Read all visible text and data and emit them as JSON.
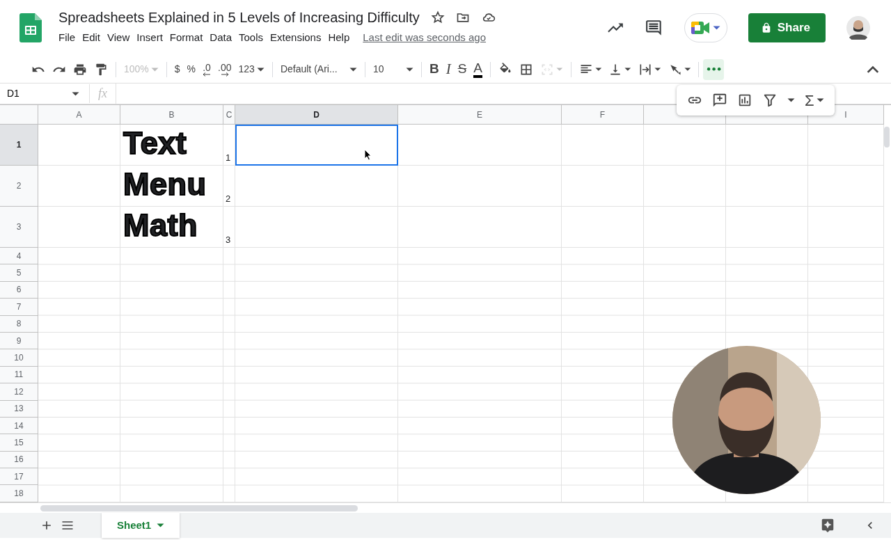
{
  "document": {
    "title": "Spreadsheets Explained in 5 Levels of Increasing Difficulty",
    "menus": [
      "File",
      "Edit",
      "View",
      "Insert",
      "Format",
      "Data",
      "Tools",
      "Extensions",
      "Help"
    ],
    "last_edit": "Last edit was seconds ago"
  },
  "share_button": "Share",
  "toolbar": {
    "zoom": {
      "value": "100%",
      "disabled": true
    },
    "currency": "$",
    "percent": "%",
    "decrease_decimal": ".0",
    "increase_decimal": ".00",
    "number_format": "123",
    "font": "Default (Ari...",
    "font_size": "10",
    "format_buttons": [
      {
        "kind": "bold",
        "label": "B"
      },
      {
        "kind": "italic",
        "label": "I"
      },
      {
        "kind": "strike",
        "label": "S"
      },
      {
        "kind": "color",
        "label": "A"
      }
    ],
    "more": {
      "expanded": true
    },
    "function_label": "Σ"
  },
  "formula_bar": {
    "name_box": "D1",
    "fx": "fx"
  },
  "columns": [
    {
      "kind": "header",
      "label": "A"
    },
    {
      "kind": "header",
      "label": "B"
    },
    {
      "kind": "header",
      "label": "C"
    },
    {
      "kind": "header",
      "label": "D"
    },
    {
      "kind": "header",
      "label": "E"
    },
    {
      "kind": "header",
      "label": "F"
    },
    {
      "kind": "covered"
    },
    {
      "kind": "covered"
    },
    {
      "kind": "header",
      "label": "I"
    }
  ],
  "rows": [
    {
      "label": "1",
      "cells": [
        null,
        {
          "kind": "display",
          "text": "Text",
          "selected": false
        },
        {
          "kind": "number",
          "text": "1",
          "selected": false
        },
        {
          "kind": "empty",
          "selected": true
        }
      ]
    },
    {
      "label": "2",
      "cells": [
        null,
        {
          "kind": "display",
          "text": "Menu",
          "selected": false
        },
        {
          "kind": "number",
          "text": "2",
          "selected": false
        }
      ]
    },
    {
      "label": "3",
      "cells": [
        null,
        {
          "kind": "display",
          "text": "Math",
          "selected": false
        },
        {
          "kind": "number",
          "text": "3",
          "selected": false
        }
      ]
    },
    {
      "label": "4"
    },
    {
      "label": "5"
    },
    {
      "label": "6"
    },
    {
      "label": "7"
    },
    {
      "label": "8"
    },
    {
      "label": "9"
    },
    {
      "label": "10"
    },
    {
      "label": "11"
    },
    {
      "label": "12"
    },
    {
      "label": "13"
    },
    {
      "label": "14"
    },
    {
      "label": "15"
    },
    {
      "label": "16"
    },
    {
      "label": "17"
    },
    {
      "label": "18"
    }
  ],
  "sheets": [
    {
      "label": "Sheet1",
      "selected": true
    }
  ]
}
